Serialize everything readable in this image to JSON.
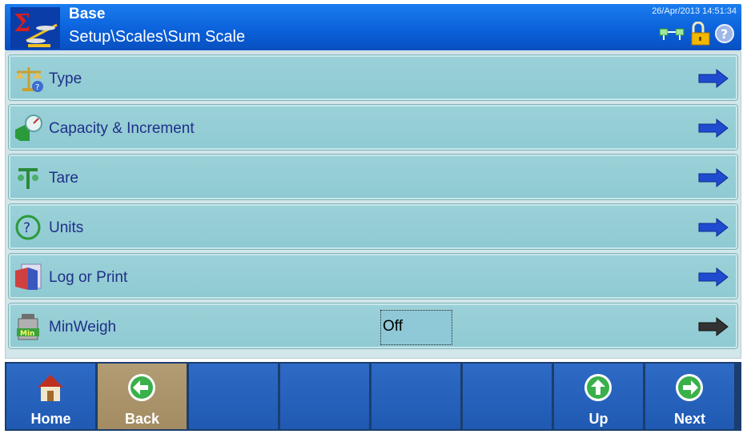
{
  "header": {
    "title": "Base",
    "path": "Setup\\Scales\\Sum Scale",
    "datetime": "26/Apr/2013 14:51:34",
    "status_icons": [
      "network-icon",
      "lock-icon",
      "help-icon"
    ]
  },
  "menu": {
    "items": [
      {
        "label": "Type",
        "icon": "scale-balance-icon",
        "arrow": "arrow-right-icon"
      },
      {
        "label": "Capacity & Increment",
        "icon": "capacity-icon",
        "arrow": "arrow-right-icon"
      },
      {
        "label": "Tare",
        "icon": "tare-icon",
        "arrow": "arrow-right-icon"
      },
      {
        "label": "Units",
        "icon": "units-icon",
        "arrow": "arrow-right-icon"
      },
      {
        "label": "Log or Print",
        "icon": "log-print-icon",
        "arrow": "arrow-right-icon"
      },
      {
        "label": "MinWeigh",
        "icon": "minweigh-icon",
        "value": "Off",
        "arrow": "arrow-right-icon"
      }
    ]
  },
  "softkeys": {
    "home": "Home",
    "back": "Back",
    "up": "Up",
    "next": "Next"
  },
  "colors": {
    "header_blue": "#0a5fd8",
    "row_teal": "#93ccd4",
    "arrow_blue": "#1f4bd0",
    "arrow_gray": "#333333",
    "softkey_blue": "#2a63bd",
    "back_tan": "#a9926a"
  }
}
